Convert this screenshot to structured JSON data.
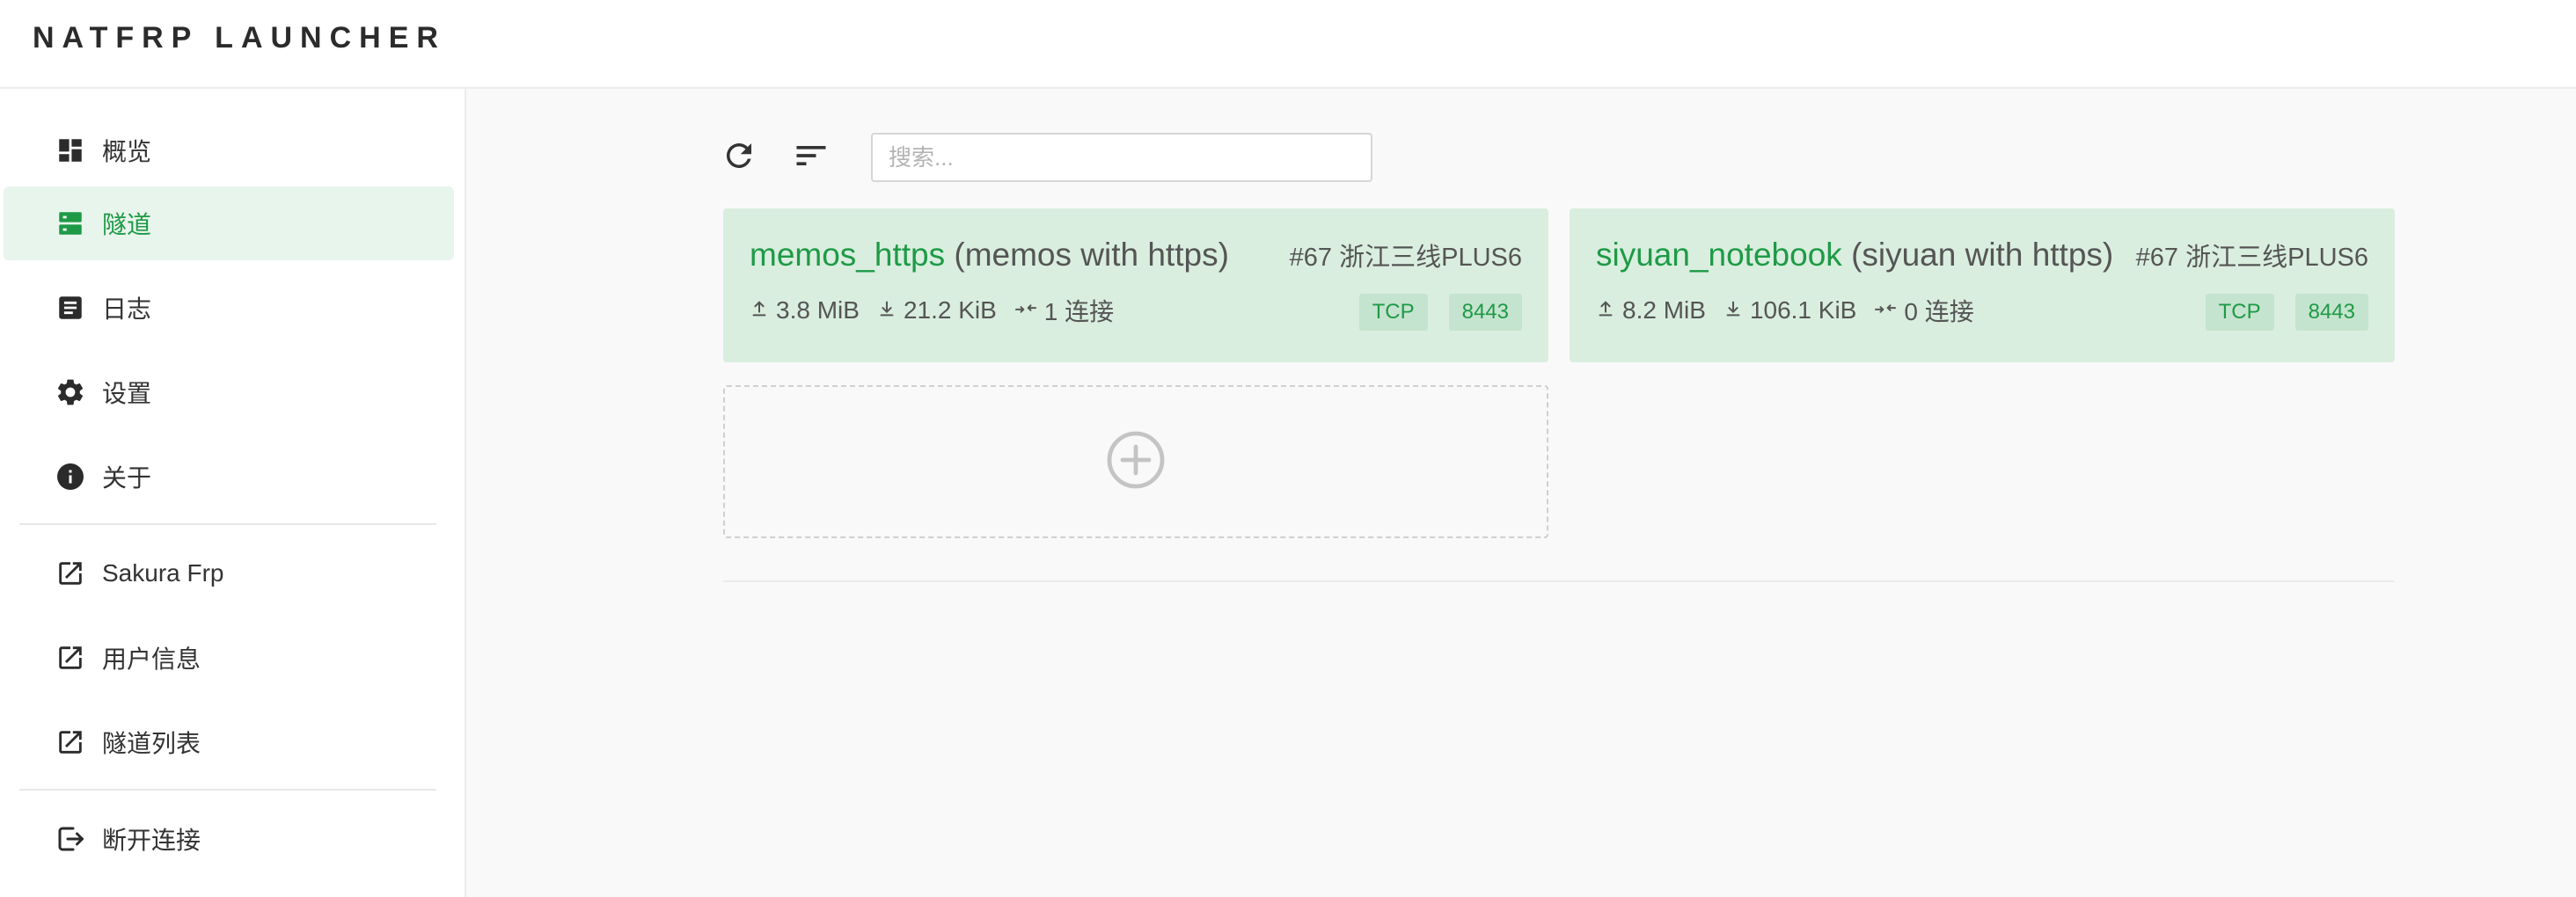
{
  "app": {
    "title": "NATFRP LAUNCHER"
  },
  "sidebar": {
    "items": [
      {
        "label": "概览",
        "icon": "dashboard-icon"
      },
      {
        "label": "隧道",
        "icon": "tunnel-icon",
        "active": true
      },
      {
        "label": "日志",
        "icon": "log-icon"
      },
      {
        "label": "设置",
        "icon": "gear-icon"
      },
      {
        "label": "关于",
        "icon": "info-icon"
      }
    ],
    "links": [
      {
        "label": "Sakura Frp",
        "icon": "external-link-icon"
      },
      {
        "label": "用户信息",
        "icon": "external-link-icon"
      },
      {
        "label": "隧道列表",
        "icon": "external-link-icon"
      }
    ],
    "logout": {
      "label": "断开连接",
      "icon": "logout-icon"
    }
  },
  "toolbar": {
    "refresh_icon": "refresh-icon",
    "sort_icon": "sort-icon",
    "search_placeholder": "搜索..."
  },
  "tunnels": [
    {
      "name": "memos_https",
      "description": "(memos with https)",
      "node": "#67 浙江三线PLUS6",
      "upload": "3.8 MiB",
      "download": "21.2 KiB",
      "connections": "1 连接",
      "protocol": "TCP",
      "port": "8443"
    },
    {
      "name": "siyuan_notebook",
      "description": "(siyuan with https)",
      "node": "#67 浙江三线PLUS6",
      "upload": "8.2 MiB",
      "download": "106.1 KiB",
      "connections": "0 连接",
      "protocol": "TCP",
      "port": "8443"
    }
  ],
  "add_tunnel": {
    "icon": "add-circle-icon"
  },
  "colors": {
    "accent": "#1e9a46",
    "card_bg": "#d9eedf",
    "badge_bg": "#c5e4cf",
    "active_nav_bg": "#e8f5ec"
  }
}
